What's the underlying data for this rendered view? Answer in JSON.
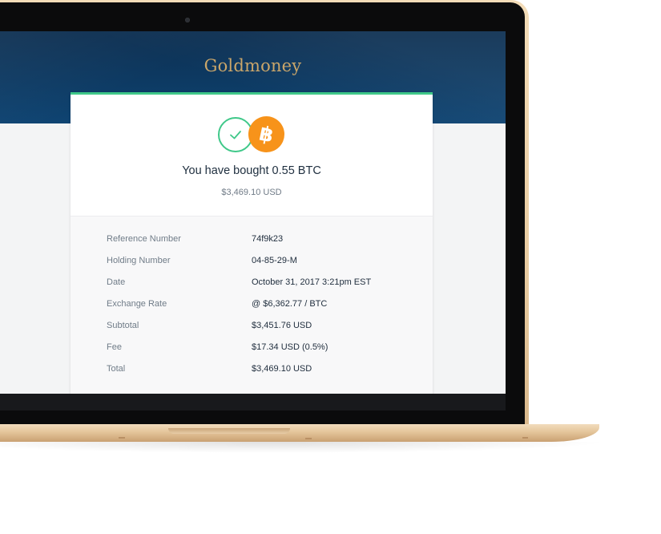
{
  "app": {
    "logo": "Goldmoney"
  },
  "confirmation": {
    "headline": "You have bought 0.55 BTC",
    "amount": "$3,469.10 USD",
    "bitcoin_symbol": "฿"
  },
  "details": [
    {
      "label": "Reference Number",
      "value": "74f9k23"
    },
    {
      "label": "Holding Number",
      "value": "04-85-29-M"
    },
    {
      "label": "Date",
      "value": "October 31, 2017 3:21pm EST"
    },
    {
      "label": "Exchange Rate",
      "value": "@ $6,362.77 / BTC"
    },
    {
      "label": "Subtotal",
      "value": "$3,451.76 USD"
    },
    {
      "label": "Fee",
      "value": "$17.34 USD (0.5%)"
    },
    {
      "label": "Total",
      "value": "$3,469.10 USD"
    }
  ],
  "icons": {
    "success": "check-icon",
    "currency": "bitcoin-icon"
  },
  "colors": {
    "accent_green": "#3fc889",
    "bitcoin_orange": "#f7931a",
    "brand_gold": "#caa66a",
    "banner_navy": "#0d3a63"
  }
}
